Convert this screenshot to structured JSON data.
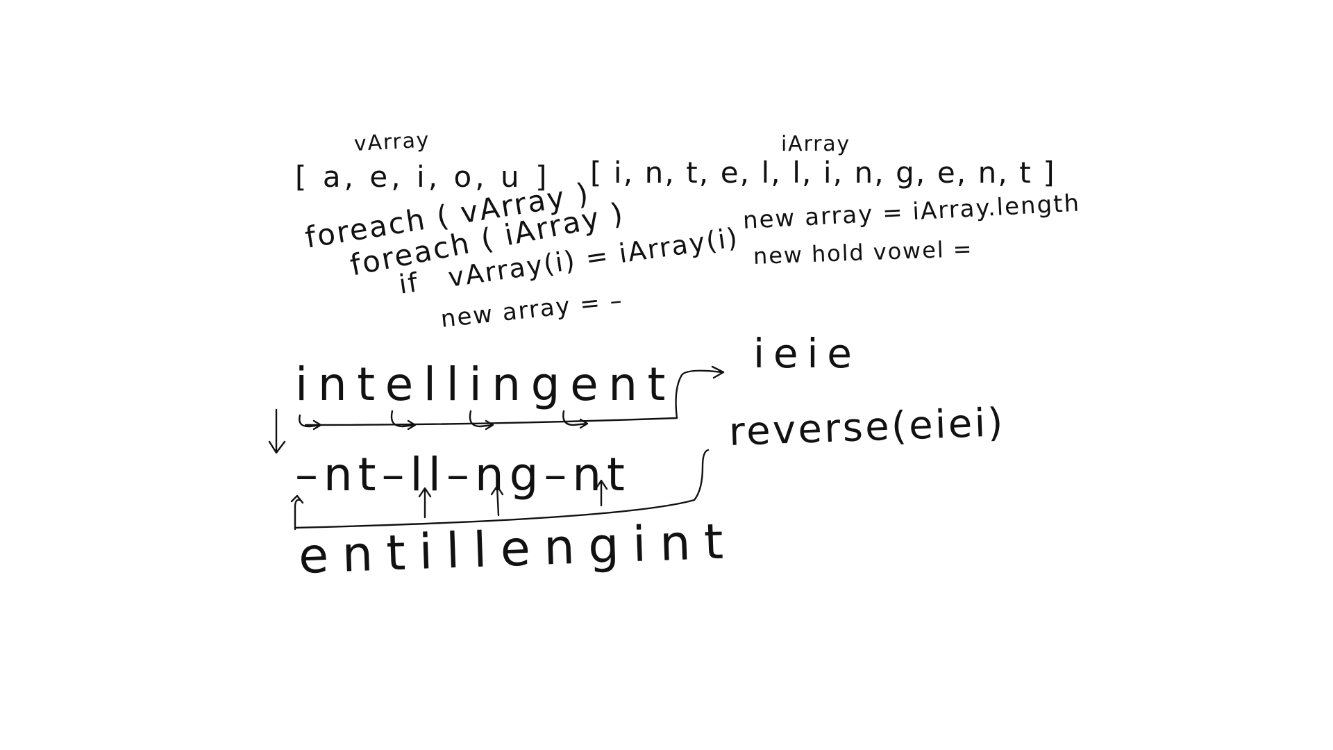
{
  "whiteboard": {
    "vowel_array": {
      "label": "vArray",
      "values": "[ a, e, i, o, u ]"
    },
    "input_array": {
      "label": "iArray",
      "values": "[ i, n, t, e, l, l, i, n, g, e, n, t ]"
    },
    "pseudocode": {
      "line1": "foreach ( vArray )",
      "line2": "foreach ( iArray )",
      "line3": "if   vArray(i) = iArray(i)",
      "line4": "new array = –"
    },
    "notes": {
      "line1": "new array = iArray.length",
      "line2": "new hold vowel ="
    },
    "example": {
      "word": "intellingent",
      "extracted_vowels": "ieie",
      "stripped_word": "–nt–ll–ng–nt",
      "reverse_call": "reverse(eiei)",
      "result": "entillengint"
    }
  }
}
